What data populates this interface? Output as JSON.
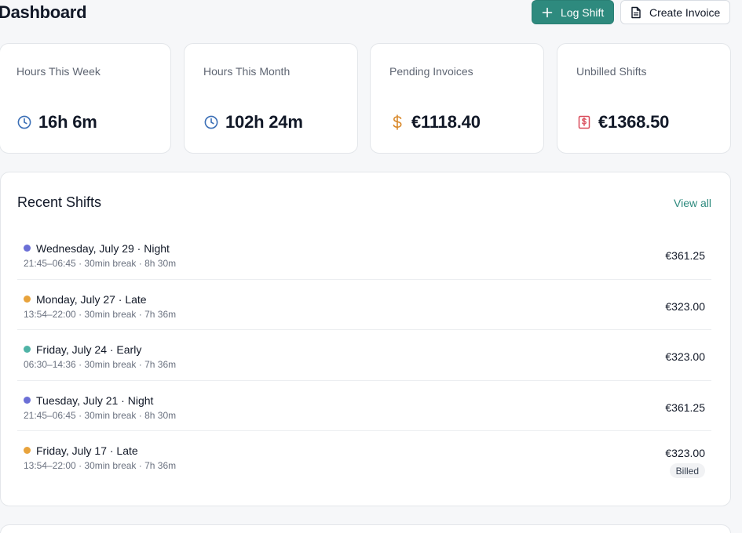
{
  "header": {
    "title": "Dashboard",
    "log_shift_label": "Log Shift",
    "create_invoice_label": "Create Invoice"
  },
  "stats": [
    {
      "label": "Hours This Week",
      "value": "16h 6m",
      "icon": "clock-icon",
      "color": "#3b6fb6"
    },
    {
      "label": "Hours This Month",
      "value": "102h 24m",
      "icon": "clock-icon",
      "color": "#3b6fb6"
    },
    {
      "label": "Pending Invoices",
      "value": "€1118.40",
      "icon": "dollar-icon",
      "color": "#d9892b"
    },
    {
      "label": "Unbilled Shifts",
      "value": "€1368.50",
      "icon": "receipt-icon",
      "color": "#d94b5a"
    }
  ],
  "recent_shifts": {
    "title": "Recent Shifts",
    "view_all_label": "View all",
    "items": [
      {
        "title": "Wednesday, July 29 · Night",
        "details": "21:45–06:45 · 30min break · 8h 30m",
        "amount": "€361.25",
        "dot_color": "#6b6fd6",
        "badge": ""
      },
      {
        "title": "Monday, July 27 · Late",
        "details": "13:54–22:00 · 30min break · 7h 36m",
        "amount": "€323.00",
        "dot_color": "#e8a33c",
        "badge": ""
      },
      {
        "title": "Friday, July 24 · Early",
        "details": "06:30–14:36 · 30min break · 7h 36m",
        "amount": "€323.00",
        "dot_color": "#4fb3a6",
        "badge": ""
      },
      {
        "title": "Tuesday, July 21 · Night",
        "details": "21:45–06:45 · 30min break · 8h 30m",
        "amount": "€361.25",
        "dot_color": "#6b6fd6",
        "badge": ""
      },
      {
        "title": "Friday, July 17 · Late",
        "details": "13:54–22:00 · 30min break · 7h 36m",
        "amount": "€323.00",
        "dot_color": "#e8a33c",
        "badge": "Billed"
      }
    ]
  },
  "colors": {
    "accent": "#2e8a7e",
    "background": "#f6f7f9",
    "card": "#ffffff"
  }
}
